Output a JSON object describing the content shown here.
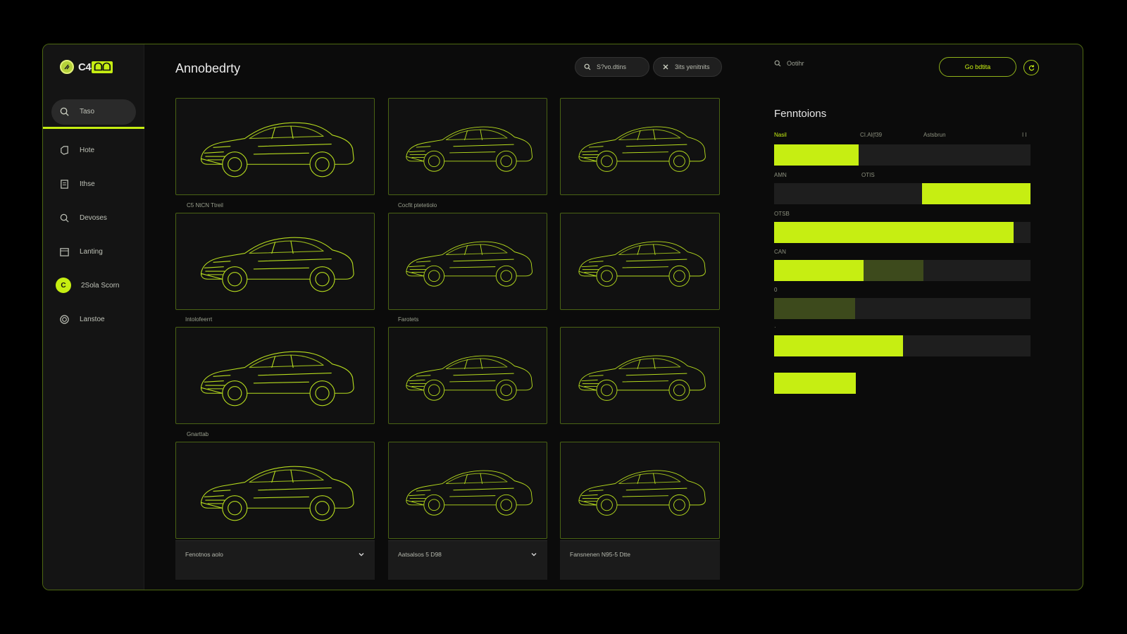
{
  "app": {
    "logo_text": "C4",
    "logo_chip": "ᗝᗝ",
    "page_title": "Annobedrty"
  },
  "sidebar": {
    "items": [
      {
        "label": "Taso",
        "icon": "search-icon"
      },
      {
        "label": "Hote",
        "icon": "tag-icon"
      },
      {
        "label": "Ithse",
        "icon": "document-icon"
      },
      {
        "label": "Devoses",
        "icon": "search-icon"
      },
      {
        "label": "Lanting",
        "icon": "calendar-icon"
      },
      {
        "label": "2Sola Scorn",
        "icon": "badge-icon",
        "badge": "C"
      },
      {
        "label": "Lanstoe",
        "icon": "target-icon"
      }
    ]
  },
  "toolbar": {
    "pill1": "S?vo.dtins",
    "pill2": "3its yenitnits"
  },
  "grid": {
    "labels": [
      "C5 NtCN Ttreil",
      "Cocfit ptetetiolo",
      "Intolofeerrt",
      "Farotets",
      "Gnarttab"
    ],
    "dropdowns": [
      "Fenotnos aolo",
      "Aatsalsos 5 D98",
      "Fansnenen N95-5 Dtte"
    ]
  },
  "right": {
    "search_text": "Ootihr",
    "go_button": "Go bdtita",
    "title": "Fenntoions",
    "columns": [
      "Nasil",
      "CI.Al(f39",
      "Astsbrun",
      "I I"
    ],
    "bars": [
      {
        "label": "",
        "segments": [
          {
            "start": 0,
            "end": 0.33,
            "style": "bright"
          }
        ]
      },
      {
        "label": "AMN",
        "label2": "OTIS",
        "segments": [
          {
            "start": 0.576,
            "end": 1.0,
            "style": "bright"
          }
        ]
      },
      {
        "label": "OTSB",
        "segments": [
          {
            "start": 0,
            "end": 0.935,
            "style": "bright"
          }
        ]
      },
      {
        "label": "CAN",
        "segments": [
          {
            "start": 0,
            "end": 0.35,
            "style": "bright"
          },
          {
            "start": 0.35,
            "end": 0.582,
            "style": "dim"
          }
        ]
      },
      {
        "label": "0",
        "segments": [
          {
            "start": 0,
            "end": 0.315,
            "style": "dim"
          }
        ]
      },
      {
        "label": "·",
        "segments": [
          {
            "start": 0,
            "end": 0.502,
            "style": "bright"
          }
        ]
      },
      {
        "label": "",
        "segments": [
          {
            "start": 0,
            "end": 0.32,
            "style": "bright"
          }
        ],
        "track": false
      }
    ]
  },
  "colors": {
    "accent": "#c6ee12",
    "border": "#4a6314",
    "bg": "#0b0b0b"
  }
}
